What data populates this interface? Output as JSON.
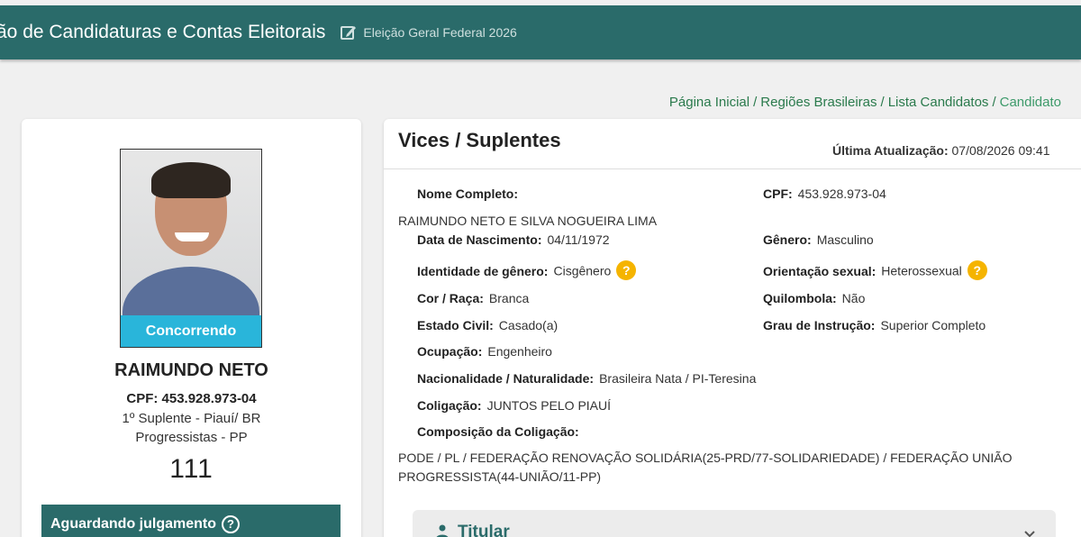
{
  "header": {
    "app_title": "ão de Candidaturas e Contas Eleitorais",
    "election": "Eleição Geral Federal 2026",
    "edit_icon": "edit-icon"
  },
  "breadcrumb": {
    "items": [
      "Página Inicial",
      "Regiões Brasileiras",
      "Lista Candidatos",
      "Candidato"
    ],
    "separator": "/"
  },
  "candidate": {
    "status": "Concorrendo",
    "name": "RAIMUNDO NETO",
    "cpf": "CPF: 453.928.973-04",
    "role": "1º Suplente - Piauí/ BR",
    "party": "Progressistas - PP",
    "number": "111",
    "judgement": "Aguardando julgamento"
  },
  "details": {
    "title": "Vices / Suplentes",
    "updated_label": "Última Atualização:",
    "updated_value": "07/08/2026 09:41",
    "full_name_label": "Nome Completo:",
    "full_name_value": "RAIMUNDO NETO E SILVA NOGUEIRA LIMA",
    "cpf_label": "CPF:",
    "cpf_value": "453.928.973-04",
    "birth_label": "Data de Nascimento:",
    "birth_value": "04/11/1972",
    "gender_label": "Gênero:",
    "gender_value": "Masculino",
    "gender_identity_label": "Identidade de gênero:",
    "gender_identity_value": "Cisgênero",
    "orientation_label": "Orientação sexual:",
    "orientation_value": "Heterossexual",
    "race_label": "Cor / Raça:",
    "race_value": "Branca",
    "quilombola_label": "Quilombola:",
    "quilombola_value": "Não",
    "civil_label": "Estado Civil:",
    "civil_value": "Casado(a)",
    "education_label": "Grau de Instrução:",
    "education_value": "Superior Completo",
    "occupation_label": "Ocupação:",
    "occupation_value": "Engenheiro",
    "nationality_label": "Nacionalidade / Naturalidade:",
    "nationality_value": "Brasileira Nata / PI-Teresina",
    "coalition_label": "Coligação:",
    "coalition_value": "JUNTOS PELO PIAUÍ",
    "composition_label": "Composição da Coligação:",
    "composition_value": "PODE / PL / FEDERAÇÃO RENOVAÇÃO SOLIDÁRIA(25-PRD/77-SOLIDARIEDADE) / FEDERAÇÃO UNIÃO PROGRESSISTA(44-UNIÃO/11-PP)",
    "help_glyph": "?"
  },
  "accordion": {
    "label": "Titular",
    "icon": "person-icon"
  },
  "colors": {
    "primary": "#2a6b6a",
    "status": "#29b5da",
    "help": "#f5b400",
    "breadcrumb": "#2a7a4c"
  }
}
